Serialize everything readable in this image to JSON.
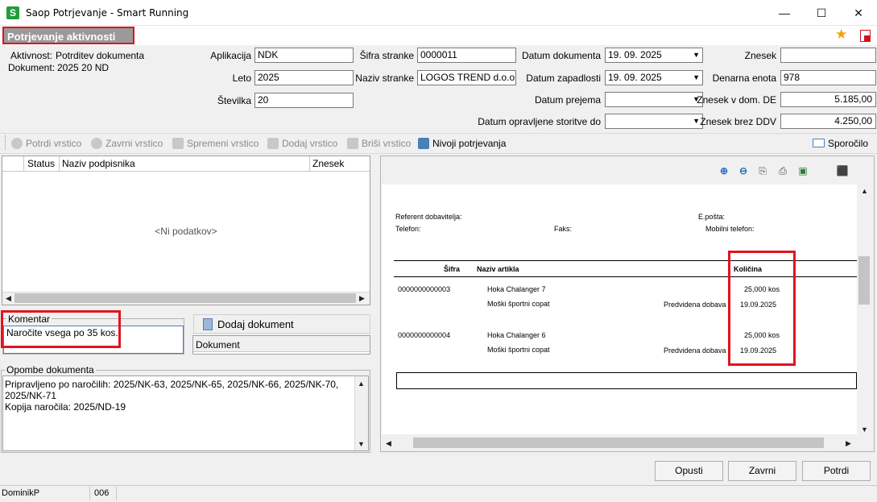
{
  "window": {
    "title": "Saop Potrjevanje - Smart Running",
    "app_icon": "S",
    "minimize": "—",
    "maximize": "☐",
    "close": "✕"
  },
  "section_title": "Potrjevanje aktivnosti",
  "info": {
    "aktivnost_label": "Aktivnost:",
    "aktivnost_value": "Potrditev dokumenta",
    "dokument_label": "Dokument:",
    "dokument_value": "2025 20 ND"
  },
  "form": {
    "aplikacija_label": "Aplikacija",
    "aplikacija_value": "NDK",
    "leto_label": "Leto",
    "leto_value": "2025",
    "stevilka_label": "Številka",
    "stevilka_value": "20",
    "sifra_stranke_label": "Šifra stranke",
    "sifra_stranke_value": "0000011",
    "naziv_stranke_label": "Naziv stranke",
    "naziv_stranke_value": "LOGOS TREND d.o.o.",
    "datum_dokumenta_label": "Datum dokumenta",
    "datum_dokumenta_value": "19. 09. 2025",
    "datum_zapadlosti_label": "Datum zapadlosti",
    "datum_zapadlosti_value": "19. 09. 2025",
    "datum_prejema_label": "Datum prejema",
    "datum_prejema_value": "",
    "datum_storitve_label": "Datum opravljene storitve do",
    "datum_storitve_value": "",
    "znesek_label": "Znesek",
    "znesek_value": "",
    "denarna_enota_label": "Denarna enota",
    "denarna_enota_value": "978",
    "znesek_dom_label": "Znesek v dom. DE",
    "znesek_dom_value": "5.185,00",
    "znesek_brez_ddv_label": "Znesek brez DDV",
    "znesek_brez_ddv_value": "4.250,00"
  },
  "toolbar": {
    "potrdi_vrstico": "Potrdi vrstico",
    "zavrni_vrstico": "Zavrni vrstico",
    "spremeni_vrstico": "Spremeni vrstico",
    "dodaj_vrstico": "Dodaj vrstico",
    "brisi_vrstico": "Briši vrstico",
    "nivoji_potrjevanja": "Nivoji potrjevanja",
    "sporocilo": "Sporočilo"
  },
  "grid": {
    "columns": [
      "Status",
      "Naziv podpisnika",
      "Znesek"
    ],
    "empty_text": "<Ni podatkov>"
  },
  "komentar": {
    "label": "Komentar",
    "value": "Naročite vsega po 35 kos."
  },
  "dokument_panel": {
    "add_button": "Dodaj dokument",
    "column": "Dokument"
  },
  "opombe": {
    "label": "Opombe dokumenta",
    "line1": "Pripravljeno po naročilih: 2025/NK-63, 2025/NK-65, 2025/NK-66, 2025/NK-70,",
    "line2": "2025/NK-71",
    "line3": "Kopija naročila: 2025/ND-19"
  },
  "preview": {
    "referent": "Referent dobavitelja:",
    "telefon": "Telefon:",
    "faks": "Faks:",
    "eposta": "E.pošta:",
    "mobilni": "Mobilni telefon:",
    "col_sifra": "Šifra",
    "col_naziv": "Naziv artikla",
    "col_kolicina": "Količina",
    "items": [
      {
        "sifra": "0000000000003",
        "naziv": "Hoka Chalanger 7",
        "opis": "Moški športni copat",
        "dobava_label": "Predvidena dobava",
        "kolicina": "25,000 kos",
        "datum": "19.09.2025"
      },
      {
        "sifra": "0000000000004",
        "naziv": "Hoka Chalanger 6",
        "opis": "Moški športni copat",
        "dobava_label": "Predvidena dobava",
        "kolicina": "25,000 kos",
        "datum": "19.09.2025"
      }
    ]
  },
  "buttons": {
    "opusti": "Opusti",
    "zavrni": "Zavrni",
    "potrdi": "Potrdi"
  },
  "status": {
    "user": "DominikP",
    "code": "006"
  },
  "colors": {
    "highlight": "#e0141e",
    "section_bg": "#9a9a9a",
    "star": "#f0a400",
    "pdf": "#d0141a"
  }
}
